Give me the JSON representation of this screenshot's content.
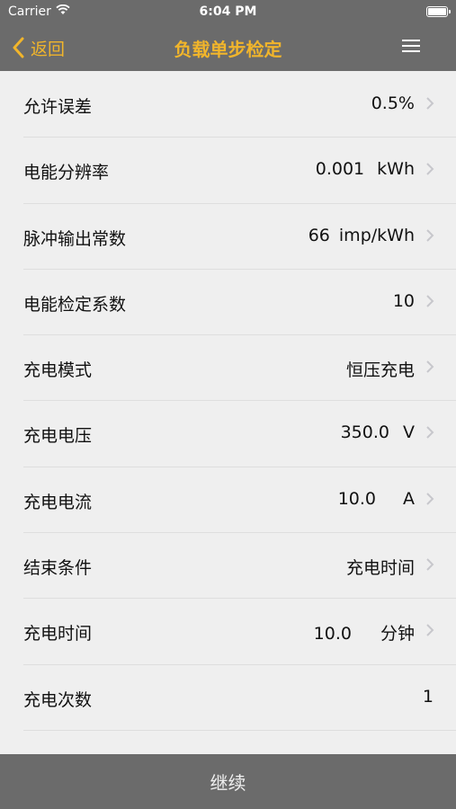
{
  "status": {
    "carrier": "Carrier",
    "time": "6:04 PM"
  },
  "nav": {
    "back_label": "返回",
    "title": "负载单步检定"
  },
  "rows": [
    {
      "label": "允许误差",
      "value": "0.5%",
      "unit": ""
    },
    {
      "label": "电能分辨率",
      "value": "0.001",
      "unit": "kWh"
    },
    {
      "label": "脉冲输出常数",
      "value": "66",
      "unit": "imp/kWh"
    },
    {
      "label": "电能检定系数",
      "value": "10",
      "unit": ""
    },
    {
      "label": "充电模式",
      "value": "恒压充电",
      "unit": ""
    },
    {
      "label": "充电电压",
      "value": "350.0",
      "unit": "V"
    },
    {
      "label": "充电电流",
      "value": "10.0",
      "unit": "A"
    },
    {
      "label": "结束条件",
      "value": "充电时间",
      "unit": ""
    },
    {
      "label": "充电时间",
      "value": "10.0",
      "unit": "分钟"
    },
    {
      "label": "充电次数",
      "value": "1",
      "unit": ""
    }
  ],
  "footer": {
    "continue_label": "继续"
  },
  "colors": {
    "bar": "#6b6b6b",
    "accent": "#f1b52b",
    "background": "#efefef"
  }
}
